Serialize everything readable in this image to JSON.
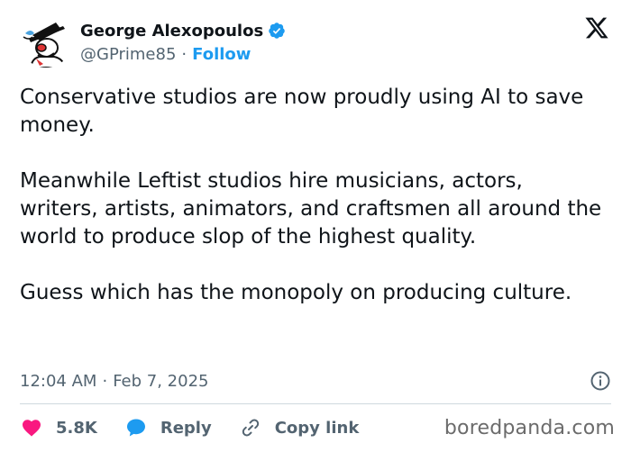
{
  "author": {
    "display_name": "George Alexopoulos",
    "handle": "@GPrime85",
    "separator": "·",
    "follow_label": "Follow",
    "verified": true,
    "avatar_icon": "hat-cartoon-avatar"
  },
  "tweet": {
    "paragraphs": [
      "Conservative studios are now proudly using AI to save money.",
      "Meanwhile Leftist studios hire musicians, actors, writers, artists, animators, and craftsmen all around the world to produce slop of the highest quality.",
      "Guess which has the monopoly on producing culture."
    ]
  },
  "meta": {
    "time": "12:04 AM",
    "separator": "·",
    "date": "Feb 7, 2025"
  },
  "actions": {
    "like_count": "5.8K",
    "reply_label": "Reply",
    "copy_link_label": "Copy link"
  },
  "icons": {
    "platform": "x-logo-icon",
    "info": "info-icon",
    "like": "heart-icon",
    "reply": "speech-bubble-icon",
    "copy_link": "link-icon"
  },
  "watermark": "boredpanda.com",
  "colors": {
    "text": "#0f1419",
    "secondary": "#536471",
    "link_blue": "#1d9bf0",
    "like_pink": "#f91880",
    "divider": "#cfd9de"
  }
}
